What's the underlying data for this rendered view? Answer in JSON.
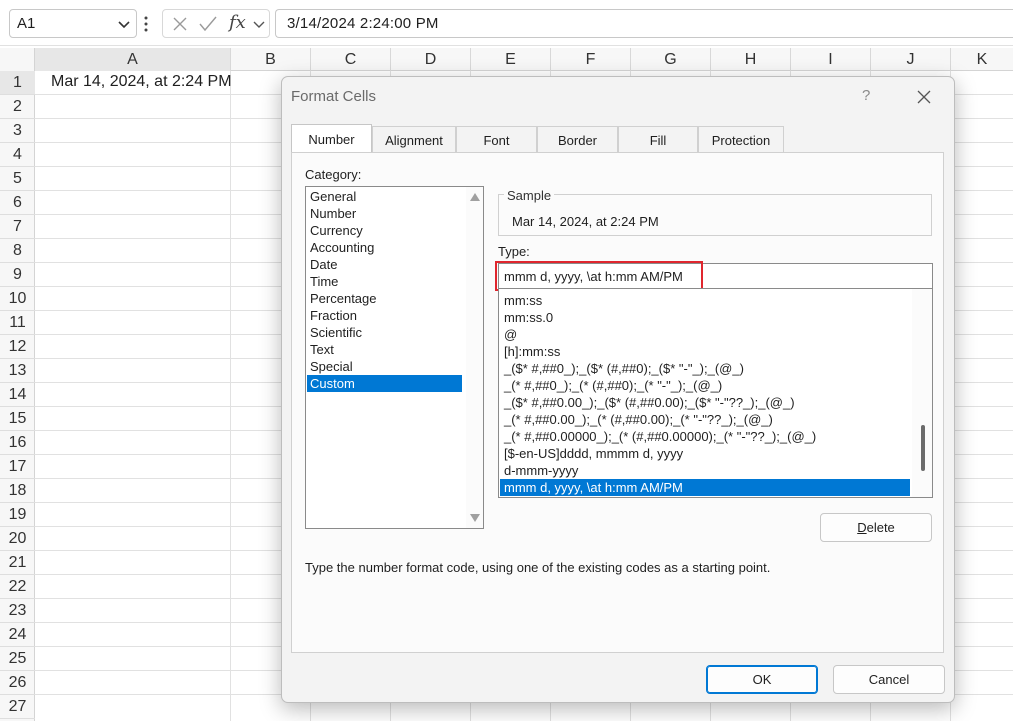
{
  "formula_bar": {
    "name_box": "A1",
    "cancel_icon": "x-icon",
    "enter_icon": "check-icon",
    "fx_label": "fx",
    "formula_value": "3/14/2024  2:24:00 PM"
  },
  "grid": {
    "columns": [
      "A",
      "B",
      "C",
      "D",
      "E",
      "F",
      "G",
      "H",
      "I",
      "J",
      "K"
    ],
    "rows": [
      "1",
      "2",
      "3",
      "4",
      "5",
      "6",
      "7",
      "8",
      "9",
      "10",
      "11",
      "12",
      "13",
      "14",
      "15",
      "16",
      "17",
      "18",
      "19",
      "20",
      "21",
      "22",
      "23",
      "24",
      "25",
      "26",
      "27"
    ],
    "cell_a1": "Mar 14, 2024, at 2:24 PM"
  },
  "dialog": {
    "title": "Format Cells",
    "help": "?",
    "tabs": [
      "Number",
      "Alignment",
      "Font",
      "Border",
      "Fill",
      "Protection"
    ],
    "active_tab": "Number",
    "category_label": "Category:",
    "categories": [
      "General",
      "Number",
      "Currency",
      "Accounting",
      "Date",
      "Time",
      "Percentage",
      "Fraction",
      "Scientific",
      "Text",
      "Special",
      "Custom"
    ],
    "selected_category": "Custom",
    "sample_label": "Sample",
    "sample_value": "Mar 14, 2024, at 2:24 PM",
    "type_label": "Type:",
    "type_value": "mmm d, yyyy, \\at h:mm AM/PM",
    "type_list": [
      "mm:ss",
      "mm:ss.0",
      "@",
      "[h]:mm:ss",
      "_($* #,##0_);_($* (#,##0);_($* \"-\"_);_(@_)",
      "_(* #,##0_);_(* (#,##0);_(* \"-\"_);_(@_)",
      "_($* #,##0.00_);_($* (#,##0.00);_($* \"-\"??_);_(@_)",
      "_(* #,##0.00_);_(* (#,##0.00);_(* \"-\"??_);_(@_)",
      "_(* #,##0.00000_);_(* (#,##0.00000);_(* \"-\"??_);_(@_)",
      "[$-en-US]dddd, mmmm d, yyyy",
      "d-mmm-yyyy",
      "mmm d, yyyy, \\at h:mm AM/PM"
    ],
    "selected_type": "mmm d, yyyy, \\at h:mm AM/PM",
    "delete_label": "Delete",
    "hint": "Type the number format code, using one of the existing codes as a starting point.",
    "ok_label": "OK",
    "cancel_label": "Cancel",
    "highlight_color": "#e0262e",
    "accent_color": "#0078d4"
  }
}
